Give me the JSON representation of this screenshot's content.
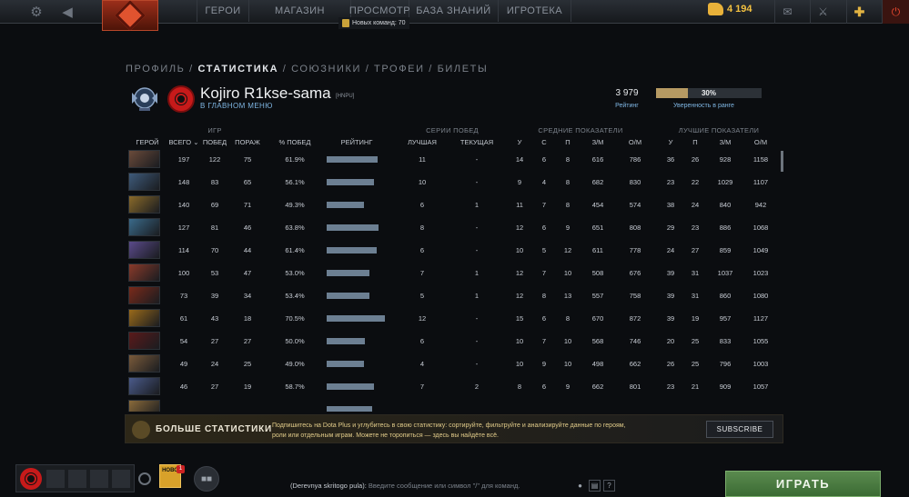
{
  "topbar": {
    "nav": [
      "ГЕРОИ",
      "МАГАЗИН",
      "ПРОСМОТР",
      "БАЗА ЗНАНИЙ",
      "ИГРОТЕКА"
    ],
    "nav_sub": "Новых команд: 70",
    "gold": "4 194",
    "icons": [
      "gear-icon",
      "back-icon",
      "mail-icon",
      "armory-icon",
      "dota-plus-icon",
      "power-icon"
    ]
  },
  "subnav": {
    "items": [
      "ПРОФИЛЬ",
      "СТАТИСТИКА",
      "СОЮЗНИКИ",
      "ТРОФЕИ",
      "БИЛЕТЫ"
    ],
    "separator": " / ",
    "active_index": 1
  },
  "profile": {
    "name": "Kojiro R1kse-sama",
    "tag": "[HNPU]",
    "status": "В ГЛАВНОМ МЕНЮ",
    "rating": "3 979",
    "rating_label": "Рейтинг",
    "confidence": "30%",
    "confidence_fraction": 0.3,
    "confidence_label": "Уверенность в ранге"
  },
  "table": {
    "groups": {
      "games": "ИГР",
      "streaks": "СЕРИИ ПОБЕД",
      "averages": "СРЕДНИЕ ПОКАЗАТЕЛИ",
      "bests": "ЛУЧШИЕ ПОКАЗАТЕЛИ"
    },
    "columns": {
      "hero": "ГЕРОЙ",
      "total": "ВСЕГО",
      "wins": "ПОБЕД",
      "losses": "ПОРАЖ",
      "winrate": "% ПОБЕД",
      "rating": "РЕЙТИНГ",
      "best_streak": "ЛУЧШАЯ",
      "current_streak": "ТЕКУЩАЯ",
      "avg_k": "У",
      "avg_d": "С",
      "avg_a": "П",
      "avg_gpm": "З/М",
      "avg_xpm": "О/М",
      "best_k": "У",
      "best_a": "П",
      "best_gpm": "З/М",
      "best_xpm": "О/М"
    },
    "rows": [
      {
        "total": "197",
        "wins": "122",
        "losses": "75",
        "winrate": "61.9%",
        "rating": 0.83,
        "best": "11",
        "current": "-",
        "k": "14",
        "d": "6",
        "a": "8",
        "gpm": "616",
        "xpm": "786",
        "bk": "36",
        "ba": "26",
        "bgpm": "928",
        "bxpm": "1158",
        "color": "#6a4a3a"
      },
      {
        "total": "148",
        "wins": "83",
        "losses": "65",
        "winrate": "56.1%",
        "rating": 0.76,
        "best": "10",
        "current": "-",
        "k": "9",
        "d": "4",
        "a": "8",
        "gpm": "682",
        "xpm": "830",
        "bk": "23",
        "ba": "22",
        "bgpm": "1029",
        "bxpm": "1107",
        "color": "#3e5a7a"
      },
      {
        "total": "140",
        "wins": "69",
        "losses": "71",
        "winrate": "49.3%",
        "rating": 0.6,
        "best": "6",
        "current": "1",
        "k": "11",
        "d": "7",
        "a": "8",
        "gpm": "454",
        "xpm": "574",
        "bk": "38",
        "ba": "24",
        "bgpm": "840",
        "bxpm": "942",
        "color": "#8a6a2a"
      },
      {
        "total": "127",
        "wins": "81",
        "losses": "46",
        "winrate": "63.8%",
        "rating": 0.84,
        "best": "8",
        "current": "-",
        "k": "12",
        "d": "6",
        "a": "9",
        "gpm": "651",
        "xpm": "808",
        "bk": "29",
        "ba": "23",
        "bgpm": "886",
        "bxpm": "1068",
        "color": "#3a6a8a"
      },
      {
        "total": "114",
        "wins": "70",
        "losses": "44",
        "winrate": "61.4%",
        "rating": 0.81,
        "best": "6",
        "current": "-",
        "k": "10",
        "d": "5",
        "a": "12",
        "gpm": "611",
        "xpm": "778",
        "bk": "24",
        "ba": "27",
        "bgpm": "859",
        "bxpm": "1049",
        "color": "#5a4a8a"
      },
      {
        "total": "100",
        "wins": "53",
        "losses": "47",
        "winrate": "53.0%",
        "rating": 0.69,
        "best": "7",
        "current": "1",
        "k": "12",
        "d": "7",
        "a": "10",
        "gpm": "508",
        "xpm": "676",
        "bk": "39",
        "ba": "31",
        "bgpm": "1037",
        "bxpm": "1023",
        "color": "#8a3a2a"
      },
      {
        "total": "73",
        "wins": "39",
        "losses": "34",
        "winrate": "53.4%",
        "rating": 0.69,
        "best": "5",
        "current": "1",
        "k": "12",
        "d": "8",
        "a": "13",
        "gpm": "557",
        "xpm": "758",
        "bk": "39",
        "ba": "31",
        "bgpm": "860",
        "bxpm": "1080",
        "color": "#7a2a1a"
      },
      {
        "total": "61",
        "wins": "43",
        "losses": "18",
        "winrate": "70.5%",
        "rating": 0.94,
        "best": "12",
        "current": "-",
        "k": "15",
        "d": "6",
        "a": "8",
        "gpm": "670",
        "xpm": "872",
        "bk": "39",
        "ba": "19",
        "bgpm": "957",
        "bxpm": "1127",
        "color": "#9a6a1a"
      },
      {
        "total": "54",
        "wins": "27",
        "losses": "27",
        "winrate": "50.0%",
        "rating": 0.62,
        "best": "6",
        "current": "-",
        "k": "10",
        "d": "7",
        "a": "10",
        "gpm": "568",
        "xpm": "746",
        "bk": "20",
        "ba": "25",
        "bgpm": "833",
        "bxpm": "1055",
        "color": "#5a1a1a"
      },
      {
        "total": "49",
        "wins": "24",
        "losses": "25",
        "winrate": "49.0%",
        "rating": 0.6,
        "best": "4",
        "current": "-",
        "k": "10",
        "d": "9",
        "a": "10",
        "gpm": "498",
        "xpm": "662",
        "bk": "26",
        "ba": "25",
        "bgpm": "796",
        "bxpm": "1003",
        "color": "#7a5a3a"
      },
      {
        "total": "46",
        "wins": "27",
        "losses": "19",
        "winrate": "58.7%",
        "rating": 0.77,
        "best": "7",
        "current": "2",
        "k": "8",
        "d": "6",
        "a": "9",
        "gpm": "662",
        "xpm": "801",
        "bk": "23",
        "ba": "21",
        "bgpm": "909",
        "bxpm": "1057",
        "color": "#4a5a8a"
      },
      {
        "total": "",
        "wins": "",
        "losses": "",
        "winrate": "",
        "rating": 0.74,
        "best": "",
        "current": "",
        "k": "",
        "d": "",
        "a": "",
        "gpm": "",
        "xpm": "",
        "bk": "",
        "ba": "",
        "bgpm": "",
        "bxpm": "",
        "color": "#8a6a3a"
      }
    ]
  },
  "banner": {
    "title": "БОЛЬШЕ СТАТИСТИКИ",
    "text": "Подпишитесь на Dota Plus и углубитесь в свою статистику: сортируйте, фильтруйте и анализируйте данные по героям, роли или отдельным играм. Можете не торопиться — здесь вы найдёте всё.",
    "button": "SUBSCRIBE"
  },
  "bottom": {
    "news_label": "НОВО",
    "news_count": "1",
    "chat_channel": "(Derevnya skritogo pula):",
    "chat_placeholder": "Введите сообщение или символ \"/\" для команд.",
    "play": "ИГРАТЬ"
  }
}
